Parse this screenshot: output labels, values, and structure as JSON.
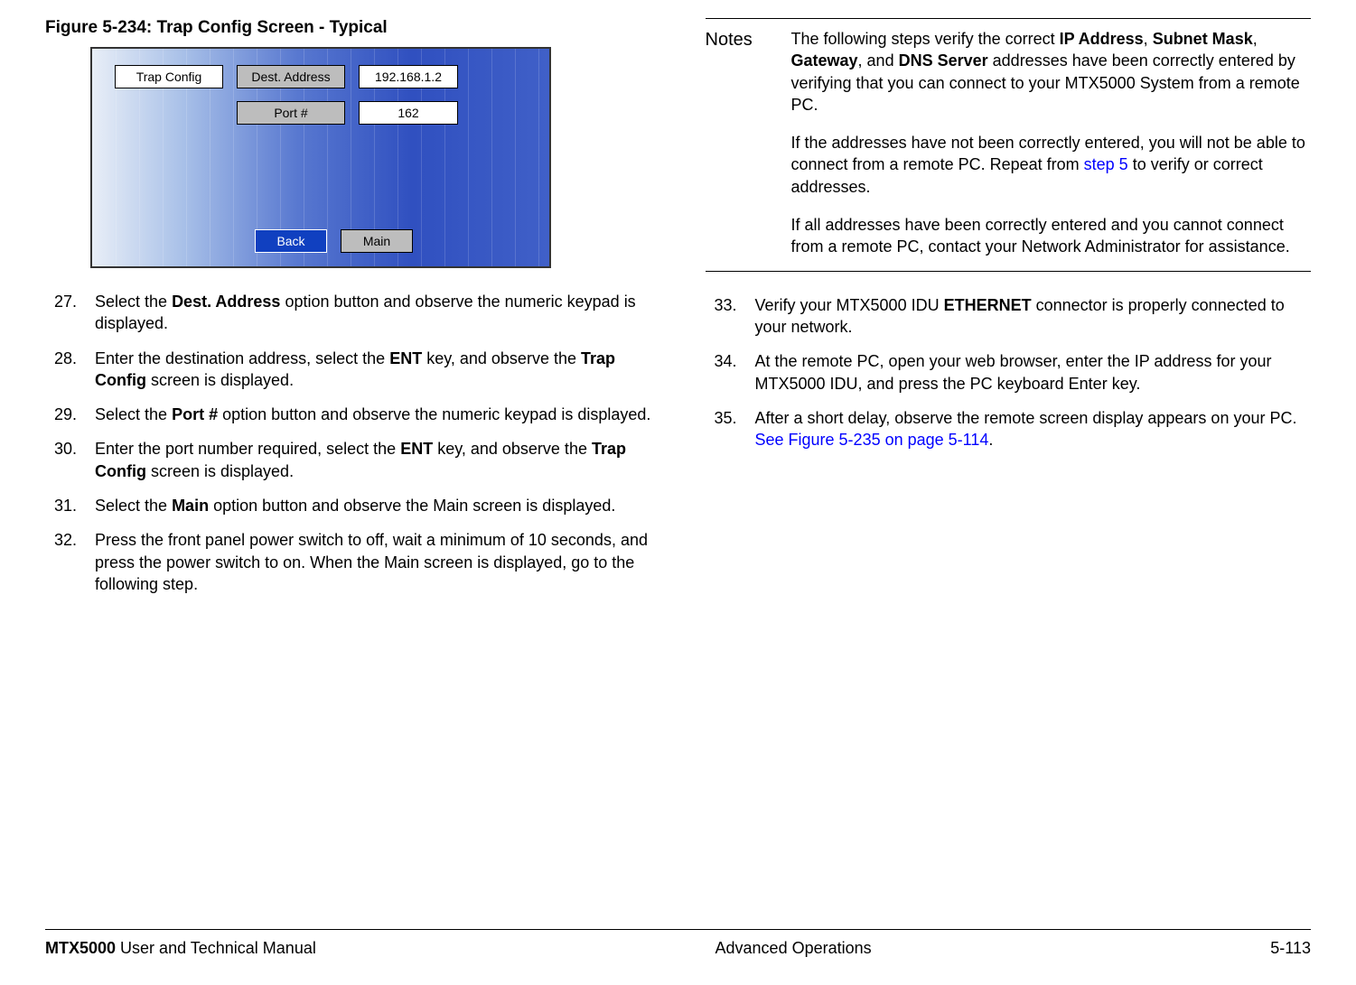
{
  "figure": {
    "title": "Figure 5-234:   Trap Config Screen - Typical",
    "trap_config": "Trap Config",
    "dest_address_label": "Dest. Address",
    "dest_address_value": "192.168.1.2",
    "port_label": "Port #",
    "port_value": "162",
    "back": "Back",
    "main": "Main"
  },
  "steps_left": [
    {
      "num": "27.",
      "text_parts": [
        "Select the ",
        "Dest. Address",
        " option button and observe the numeric keypad is displayed."
      ]
    },
    {
      "num": "28.",
      "text_parts": [
        "Enter the destination address, select the ",
        "ENT",
        " key, and observe the ",
        "Trap Config",
        " screen is displayed."
      ]
    },
    {
      "num": "29.",
      "text_parts": [
        "Select the ",
        "Port #",
        " option button and observe the numeric keypad is displayed."
      ]
    },
    {
      "num": "30.",
      "text_parts": [
        "Enter the port number required, select the ",
        "ENT",
        " key, and observe the ",
        "Trap Config",
        " screen is displayed."
      ]
    },
    {
      "num": "31.",
      "text_parts": [
        "Select the ",
        "Main",
        " option button and observe the Main screen is displayed."
      ]
    },
    {
      "num": "32.",
      "text_parts": [
        "Press the front panel power switch to off, wait a minimum of 10 seconds, and press the power switch to on.  When the Main screen is displayed, go to the following step."
      ]
    }
  ],
  "notes": {
    "label": "Notes",
    "p1_a": "The following steps verify the correct ",
    "p1_b1": "IP Address",
    "p1_c": ", ",
    "p1_b2": "Subnet Mask",
    "p1_d": ", ",
    "p1_b3": "Gateway",
    "p1_e": ", and ",
    "p1_b4": "DNS Server",
    "p1_f": " addresses have been correctly entered by verifying that you can connect to your MTX5000 System from a remote PC.",
    "p2_a": "If the addresses have not been correctly entered, you will not be able to connect from a remote PC. Repeat from ",
    "p2_link": "step 5",
    "p2_b": " to verify or correct addresses.",
    "p3": "If all addresses have been correctly entered and you cannot connect from a remote PC, contact your Network Administrator for assistance."
  },
  "steps_right": [
    {
      "num": "33.",
      "text_parts": [
        "Verify your MTX5000 IDU ",
        "ETHERNET",
        " connector is properly connected to your network."
      ]
    },
    {
      "num": "34.",
      "text_parts": [
        "At the remote PC, open your web browser, enter the IP address for your MTX5000 IDU, and press the PC keyboard Enter key."
      ]
    },
    {
      "num": "35.",
      "text_parts": [
        "After a short delay, observe the remote screen display appears on your PC.  "
      ],
      "link": "See Figure 5-235 on page 5-114",
      "after": "."
    }
  ],
  "footer": {
    "left_bold": "MTX5000",
    "left_rest": " User and Technical Manual",
    "center": "Advanced Operations",
    "right": "5-113"
  }
}
